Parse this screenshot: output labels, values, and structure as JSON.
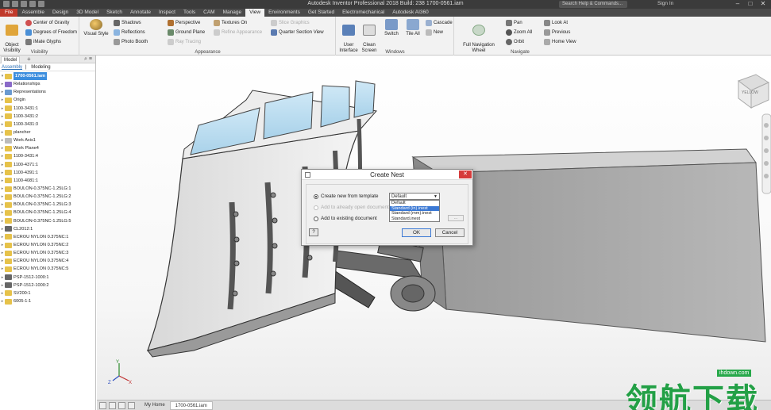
{
  "window": {
    "title": "Autodesk Inventor Professional 2018 Build: 238    1700-0561.iam",
    "search_placeholder": "Search Help & Commands...",
    "signin": "Sign In"
  },
  "tabs": [
    "File",
    "Assemble",
    "Design",
    "3D Model",
    "Sketch",
    "Annotate",
    "Inspect",
    "Tools",
    "CAM",
    "Manage",
    "View",
    "Environments",
    "Get Started",
    "Electromechanical",
    "Autodesk AI360"
  ],
  "active_tab": "View",
  "ribbon": {
    "visibility": {
      "label": "Visibility",
      "object_visibility": "Object\nVisibility",
      "center_of_gravity": "Center of Gravity",
      "degrees_of_freedom": "Degrees of Freedom",
      "imate_glyphs": "iMate Glyphs"
    },
    "appearance": {
      "label": "Appearance",
      "visual_style": "Visual Style",
      "shadows": "Shadows",
      "reflections": "Reflections",
      "photo_booth": "Photo Booth",
      "perspective": "Perspective",
      "ground_plane": "Ground Plane",
      "ray_tracing": "Ray Tracing",
      "textures_on": "Textures On",
      "refine_appearance": "Refine Appearance",
      "slice_graphics": "Slice Graphics",
      "quarter_section_view": "Quarter Section View"
    },
    "windows": {
      "label": "Windows",
      "user_interface": "User\nInterface",
      "clean_screen": "Clean\nScreen",
      "switch": "Switch",
      "tile_all": "Tile All",
      "cascade": "Cascade",
      "new": "New"
    },
    "navigate": {
      "label": "Navigate",
      "full_navigation_wheel": "Full Navigation\nWheel",
      "pan": "Pan",
      "zoom_all": "Zoom All",
      "orbit": "Orbit",
      "look_at": "Look At",
      "previous": "Previous",
      "home_view": "Home View"
    }
  },
  "browser": {
    "tab": "Model",
    "subtabs": [
      "Assembly",
      "Modeling"
    ],
    "root": "1700-0561.iam",
    "items": [
      "Relationships",
      "Representations",
      "Origin",
      "1100-3431:1",
      "1100-3431:2",
      "1100-3431:3",
      "plancher",
      "Work Axis1",
      "Work Plane4",
      "1100-3431:4",
      "1100-4371:1",
      "1100-4391:1",
      "1100-4081:1",
      "BOULON-0.375NC-1.25LG:1",
      "BOULON-0.375NC-1.25LG:2",
      "BOULON-0.375NC-1.25LG:3",
      "BOULON-0.375NC-1.25LG:4",
      "BOULON-0.375NC-1.25LG:5",
      "CL2012:1",
      "ECROU NYLON 0.375NC:1",
      "ECROU NYLON 0.375NC:2",
      "ECROU NYLON 0.375NC:3",
      "ECROU NYLON 0.375NC:4",
      "ECROU NYLON 0.375NC:5",
      "PSP-1512-1000:1",
      "PSP-1512-1000:2",
      "SV200:1",
      "6005-1:1"
    ]
  },
  "viewcube": {
    "label": "YELLOW"
  },
  "dialog": {
    "title": "Create Nest",
    "opt_new_template": "Create new from template",
    "opt_open_doc": "Add to already open document",
    "opt_existing": "Add to existing document",
    "select_value": "Default",
    "dropdown_items": [
      "Default",
      "Standard (in).inest",
      "Standard (mm).inest",
      "Standard.inest"
    ],
    "dropdown_selected_index": 1,
    "browse": "...",
    "ok": "OK",
    "cancel": "Cancel"
  },
  "doctabs": [
    "My Home",
    "1700-0561.iam"
  ],
  "watermark": {
    "url": "ihdown.com",
    "text": "领航下载"
  },
  "colors": {
    "file_tab": "#c0392b",
    "selection": "#3a78d4",
    "watermark": "#23a046"
  }
}
